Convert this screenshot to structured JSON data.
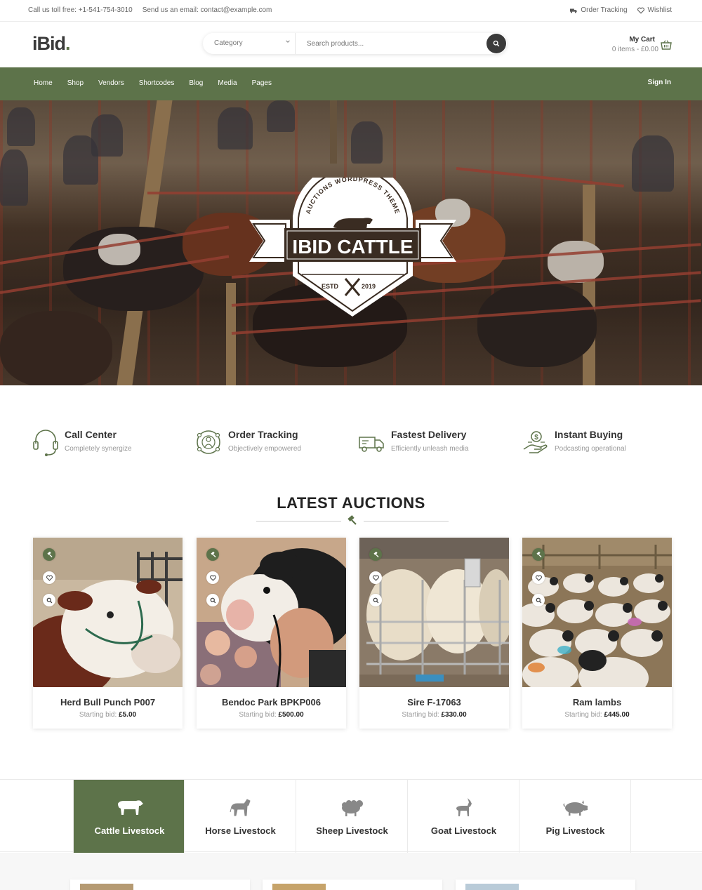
{
  "topbar": {
    "phone": "Call us toll free: +1-541-754-3010",
    "email": "Send us an email: contact@example.com",
    "order_tracking": "Order Tracking",
    "wishlist": "Wishlist"
  },
  "header": {
    "logo_text": "iBid",
    "logo_dot": ".",
    "category_label": "Category",
    "search_placeholder": "Search products...",
    "cart_title": "My Cart",
    "cart_summary": "0 items - £0.00"
  },
  "nav": {
    "items": [
      "Home",
      "Shop",
      "Vendors",
      "Shortcodes",
      "Blog",
      "Media",
      "Pages"
    ],
    "sign_in": "Sign In"
  },
  "hero": {
    "badge_arc": "AUCTIONS WORDPRESS THEME",
    "badge_title": "IBID CATTLE",
    "badge_estd": "ESTD",
    "badge_year": "2019"
  },
  "features": [
    {
      "title": "Call Center",
      "subtitle": "Completely synergize",
      "icon": "headset-icon"
    },
    {
      "title": "Order Tracking",
      "subtitle": "Objectively empowered",
      "icon": "globe-person-icon"
    },
    {
      "title": "Fastest Delivery",
      "subtitle": "Efficiently unleash media",
      "icon": "truck-icon"
    },
    {
      "title": "Instant Buying",
      "subtitle": "Podcasting operational",
      "icon": "money-hand-icon"
    }
  ],
  "auctions": {
    "title": "LATEST AUCTIONS",
    "bid_label": "Starting bid:",
    "items": [
      {
        "name": "Herd Bull Punch P007",
        "price": "£5.00"
      },
      {
        "name": "Bendoc Park BPKP006",
        "price": "£500.00"
      },
      {
        "name": "Sire F-17063",
        "price": "£330.00"
      },
      {
        "name": "Ram lambs",
        "price": "£445.00"
      }
    ]
  },
  "categories": [
    {
      "label": "Cattle Livestock",
      "icon": "cow-icon",
      "active": true
    },
    {
      "label": "Horse Livestock",
      "icon": "horse-icon",
      "active": false
    },
    {
      "label": "Sheep Livestock",
      "icon": "sheep-icon",
      "active": false
    },
    {
      "label": "Goat Livestock",
      "icon": "goat-icon",
      "active": false
    },
    {
      "label": "Pig Livestock",
      "icon": "pig-icon",
      "active": false
    }
  ],
  "colors": {
    "brand_green": "#5d734a",
    "dark": "#3a3a3a"
  }
}
